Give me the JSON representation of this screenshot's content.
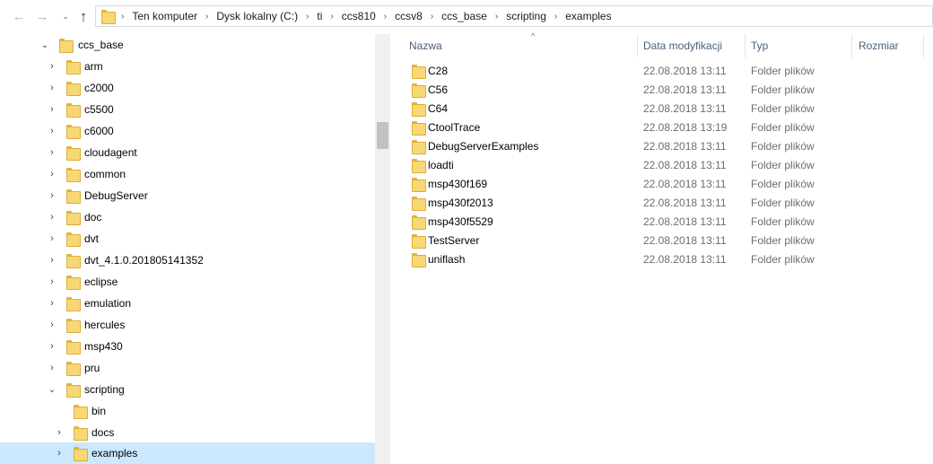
{
  "nav": {
    "back_glyph": "←",
    "forward_glyph": "→",
    "recent_glyph": "⌄",
    "up_glyph": "↑"
  },
  "address": {
    "root_chevron": "›",
    "crumbs": [
      "Ten komputer",
      "Dysk lokalny (C:)",
      "ti",
      "ccs810",
      "ccsv8",
      "ccs_base",
      "scripting",
      "examples"
    ],
    "separator": "›"
  },
  "tree": {
    "items": [
      {
        "label": "ccs_base",
        "chevron": "⌄"
      },
      {
        "label": "arm",
        "chevron": "›"
      },
      {
        "label": "c2000",
        "chevron": "›"
      },
      {
        "label": "c5500",
        "chevron": "›"
      },
      {
        "label": "c6000",
        "chevron": "›"
      },
      {
        "label": "cloudagent",
        "chevron": "›"
      },
      {
        "label": "common",
        "chevron": "›"
      },
      {
        "label": "DebugServer",
        "chevron": "›"
      },
      {
        "label": "doc",
        "chevron": "›"
      },
      {
        "label": "dvt",
        "chevron": "›"
      },
      {
        "label": "dvt_4.1.0.201805141352",
        "chevron": "›"
      },
      {
        "label": "eclipse",
        "chevron": "›"
      },
      {
        "label": "emulation",
        "chevron": "›"
      },
      {
        "label": "hercules",
        "chevron": "›"
      },
      {
        "label": "msp430",
        "chevron": "›"
      },
      {
        "label": "pru",
        "chevron": "›"
      },
      {
        "label": "scripting",
        "chevron": "⌄"
      },
      {
        "label": "bin",
        "chevron": ""
      },
      {
        "label": "docs",
        "chevron": "›"
      },
      {
        "label": "examples",
        "chevron": "›"
      }
    ]
  },
  "list": {
    "sort_glyph": "^",
    "columns": {
      "name": "Nazwa",
      "date": "Data modyfikacji",
      "type": "Typ",
      "size": "Rozmiar"
    },
    "rows": [
      {
        "name": "C28",
        "date": "22.08.2018 13:11",
        "type": "Folder plików"
      },
      {
        "name": "C56",
        "date": "22.08.2018 13:11",
        "type": "Folder plików"
      },
      {
        "name": "C64",
        "date": "22.08.2018 13:11",
        "type": "Folder plików"
      },
      {
        "name": "CtoolTrace",
        "date": "22.08.2018 13:19",
        "type": "Folder plików"
      },
      {
        "name": "DebugServerExamples",
        "date": "22.08.2018 13:11",
        "type": "Folder plików"
      },
      {
        "name": "loadti",
        "date": "22.08.2018 13:11",
        "type": "Folder plików"
      },
      {
        "name": "msp430f169",
        "date": "22.08.2018 13:11",
        "type": "Folder plików"
      },
      {
        "name": "msp430f2013",
        "date": "22.08.2018 13:11",
        "type": "Folder plików"
      },
      {
        "name": "msp430f5529",
        "date": "22.08.2018 13:11",
        "type": "Folder plików"
      },
      {
        "name": "TestServer",
        "date": "22.08.2018 13:11",
        "type": "Folder plików"
      },
      {
        "name": "uniflash",
        "date": "22.08.2018 13:11",
        "type": "Folder plików"
      }
    ]
  },
  "colors": {
    "selection": "#cce8ff",
    "folder_fill": "#f8d775",
    "header_text": "#4c607a"
  }
}
